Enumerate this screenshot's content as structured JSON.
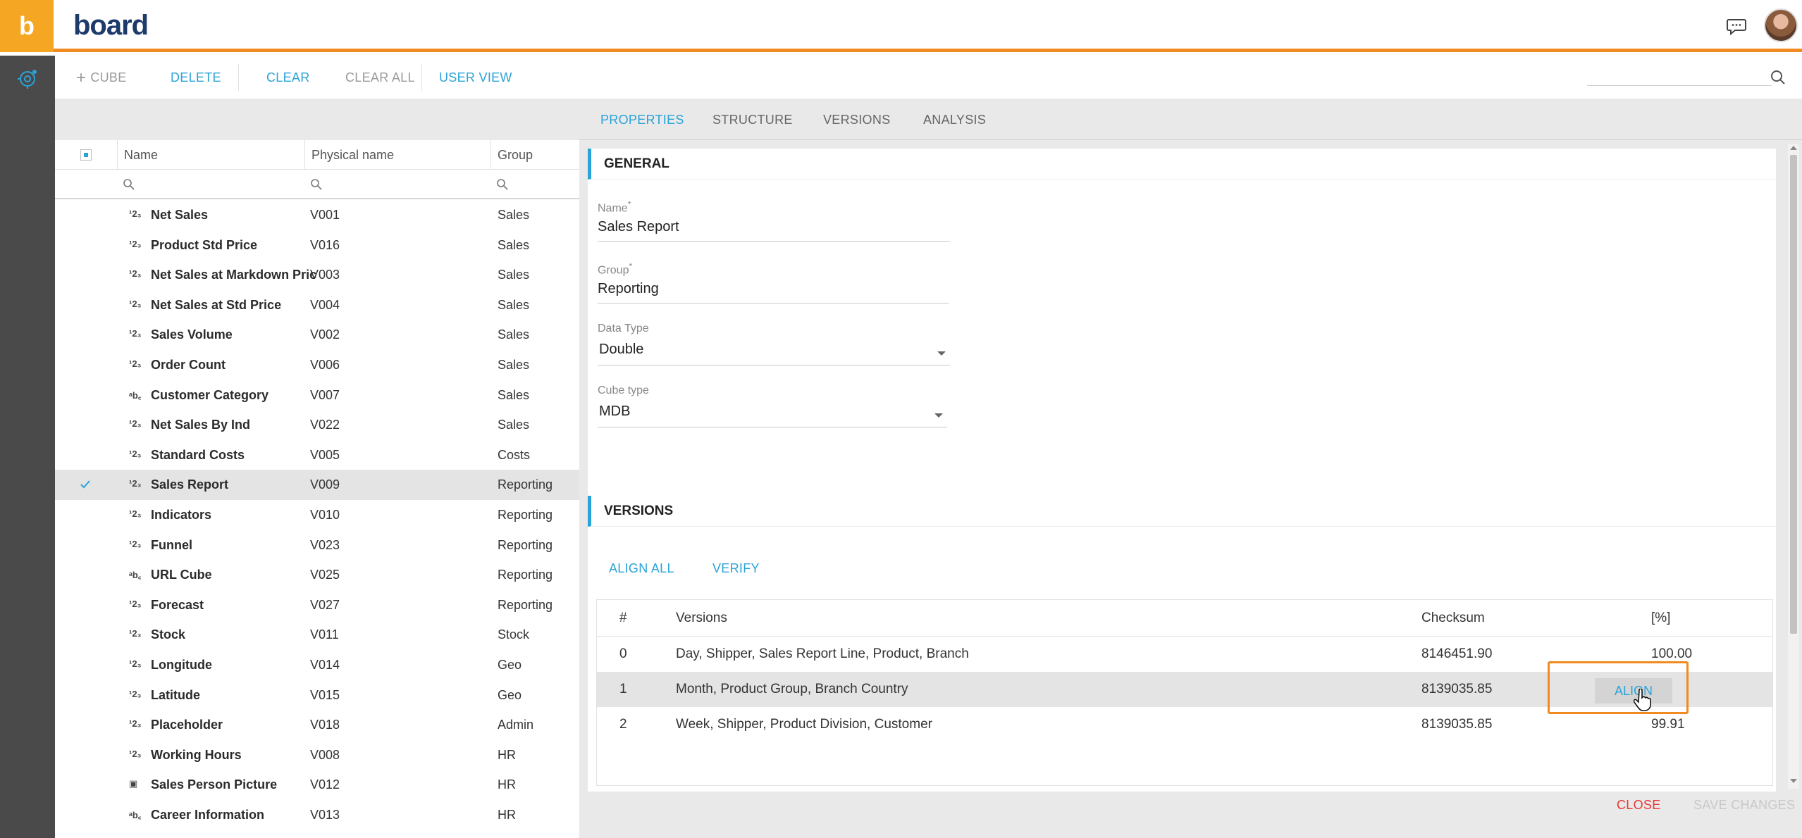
{
  "app": {
    "brand": "board",
    "logo_letter": "b"
  },
  "toolbar": {
    "add_cube": "CUBE",
    "delete": "DELETE",
    "clear": "CLEAR",
    "clear_all": "CLEAR ALL",
    "user_view": "USER VIEW",
    "search_placeholder": ""
  },
  "grid": {
    "columns": {
      "name": "Name",
      "physical": "Physical name",
      "group": "Group"
    },
    "rows": [
      {
        "icon": "123",
        "name": "Net Sales",
        "physical": "V001",
        "group": "Sales",
        "selected": false
      },
      {
        "icon": "123",
        "name": "Product Std Price",
        "physical": "V016",
        "group": "Sales",
        "selected": false
      },
      {
        "icon": "123",
        "name": "Net Sales at Markdown Pric",
        "physical": "V003",
        "group": "Sales",
        "selected": false
      },
      {
        "icon": "123",
        "name": "Net Sales at Std Price",
        "physical": "V004",
        "group": "Sales",
        "selected": false
      },
      {
        "icon": "123",
        "name": "Sales Volume",
        "physical": "V002",
        "group": "Sales",
        "selected": false
      },
      {
        "icon": "123",
        "name": "Order Count",
        "physical": "V006",
        "group": "Sales",
        "selected": false
      },
      {
        "icon": "abc",
        "name": "Customer Category",
        "physical": "V007",
        "group": "Sales",
        "selected": false
      },
      {
        "icon": "123",
        "name": "Net Sales By Ind",
        "physical": "V022",
        "group": "Sales",
        "selected": false
      },
      {
        "icon": "123",
        "name": "Standard Costs",
        "physical": "V005",
        "group": "Costs",
        "selected": false
      },
      {
        "icon": "123",
        "name": "Sales Report",
        "physical": "V009",
        "group": "Reporting",
        "selected": true
      },
      {
        "icon": "123",
        "name": "Indicators",
        "physical": "V010",
        "group": "Reporting",
        "selected": false
      },
      {
        "icon": "123",
        "name": "Funnel",
        "physical": "V023",
        "group": "Reporting",
        "selected": false
      },
      {
        "icon": "abc",
        "name": "URL Cube",
        "physical": "V025",
        "group": "Reporting",
        "selected": false
      },
      {
        "icon": "123",
        "name": "Forecast",
        "physical": "V027",
        "group": "Reporting",
        "selected": false
      },
      {
        "icon": "123",
        "name": "Stock",
        "physical": "V011",
        "group": "Stock",
        "selected": false
      },
      {
        "icon": "123",
        "name": "Longitude",
        "physical": "V014",
        "group": "Geo",
        "selected": false
      },
      {
        "icon": "123",
        "name": "Latitude",
        "physical": "V015",
        "group": "Geo",
        "selected": false
      },
      {
        "icon": "123",
        "name": "Placeholder",
        "physical": "V018",
        "group": "Admin",
        "selected": false
      },
      {
        "icon": "123",
        "name": "Working Hours",
        "physical": "V008",
        "group": "HR",
        "selected": false
      },
      {
        "icon": "img",
        "name": "Sales Person Picture",
        "physical": "V012",
        "group": "HR",
        "selected": false
      },
      {
        "icon": "abc",
        "name": "Career Information",
        "physical": "V013",
        "group": "HR",
        "selected": false
      }
    ]
  },
  "tabs": [
    {
      "label": "PROPERTIES",
      "active": true
    },
    {
      "label": "STRUCTURE",
      "active": false
    },
    {
      "label": "VERSIONS",
      "active": false
    },
    {
      "label": "ANALYSIS",
      "active": false
    }
  ],
  "general": {
    "title": "GENERAL",
    "name_label": "Name",
    "name_value": "Sales Report",
    "group_label": "Group",
    "group_value": "Reporting",
    "datatype_label": "Data Type",
    "datatype_value": "Double",
    "cubetype_label": "Cube type",
    "cubetype_value": "MDB",
    "required_mark": "*"
  },
  "versions": {
    "title": "VERSIONS",
    "align_all": "ALIGN ALL",
    "verify": "VERIFY",
    "columns": {
      "num": "#",
      "versions": "Versions",
      "checksum": "Checksum",
      "pct": "[%]"
    },
    "rows": [
      {
        "num": "0",
        "versions": "Day, Shipper, Sales Report Line, Product, Branch",
        "checksum": "8146451.90",
        "pct": "100.00",
        "align": ""
      },
      {
        "num": "1",
        "versions": "Month, Product Group, Branch Country",
        "checksum": "8139035.85",
        "pct": "",
        "align": "ALIGN"
      },
      {
        "num": "2",
        "versions": "Week, Shipper, Product Division, Customer",
        "checksum": "8139035.85",
        "pct": "99.91",
        "align": ""
      }
    ]
  },
  "footer": {
    "close": "CLOSE",
    "save": "SAVE CHANGES"
  },
  "colors": {
    "accent": "#2aa3d8",
    "brand_orange": "#f18a21",
    "danger": "#e53935"
  }
}
